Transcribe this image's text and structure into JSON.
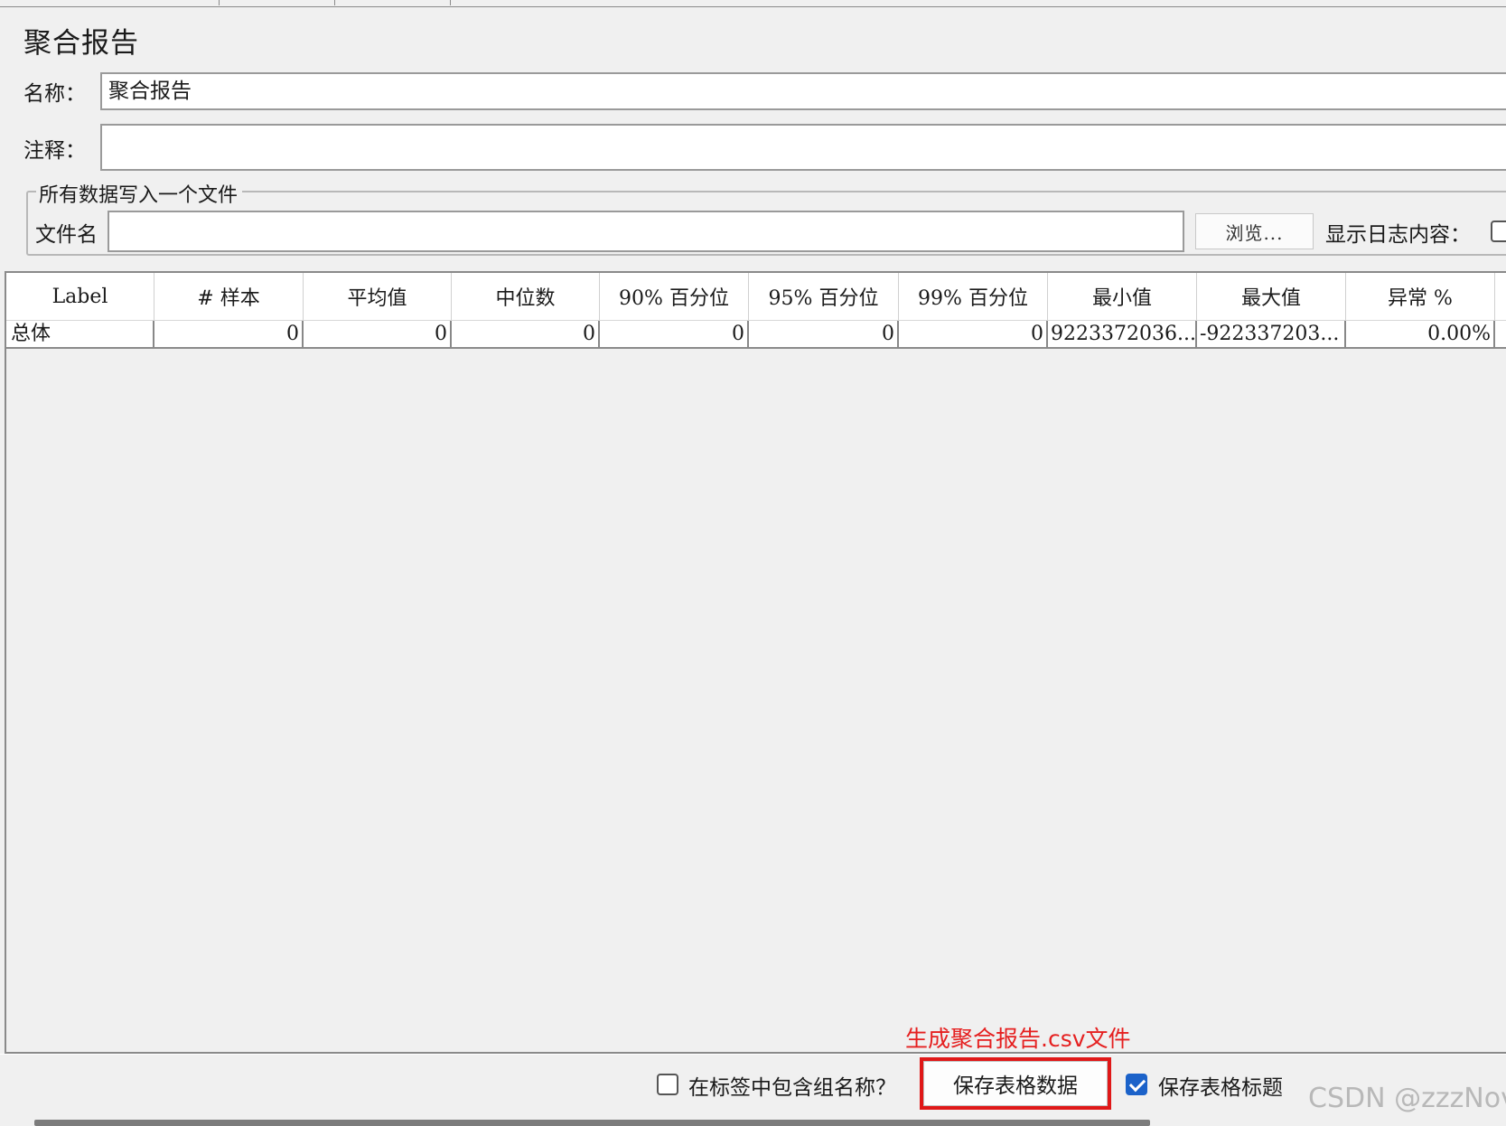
{
  "panel": {
    "title": "聚合报告"
  },
  "name_field": {
    "label": "名称：",
    "value": "聚合报告"
  },
  "comment_field": {
    "label": "注释：",
    "value": ""
  },
  "file_group": {
    "legend": "所有数据写入一个文件",
    "filename_label": "文件名",
    "filename_value": "",
    "browse_label": "浏览...",
    "log_label": "显示日志内容："
  },
  "table": {
    "headers": [
      "Label",
      "# 样本",
      "平均值",
      "中位数",
      "90% 百分位",
      "95% 百分位",
      "99% 百分位",
      "最小值",
      "最大值",
      "异常 %"
    ],
    "rows": [
      [
        "总体",
        "0",
        "0",
        "0",
        "0",
        "0",
        "0",
        "9223372036...",
        "-922337203...",
        "0.00%"
      ]
    ]
  },
  "bottom": {
    "include_group_label": "在标签中包含组名称？",
    "include_group_checked": false,
    "save_table_label": "保存表格数据",
    "save_header_label": "保存表格标题",
    "save_header_checked": true
  },
  "annotation": {
    "text": "生成聚合报告.csv文件",
    "color": "#e52020"
  },
  "watermark": {
    "text": "CSDN @zzzNov"
  },
  "colors": {
    "accent": "#1b62c9",
    "highlight": "#e01818"
  }
}
